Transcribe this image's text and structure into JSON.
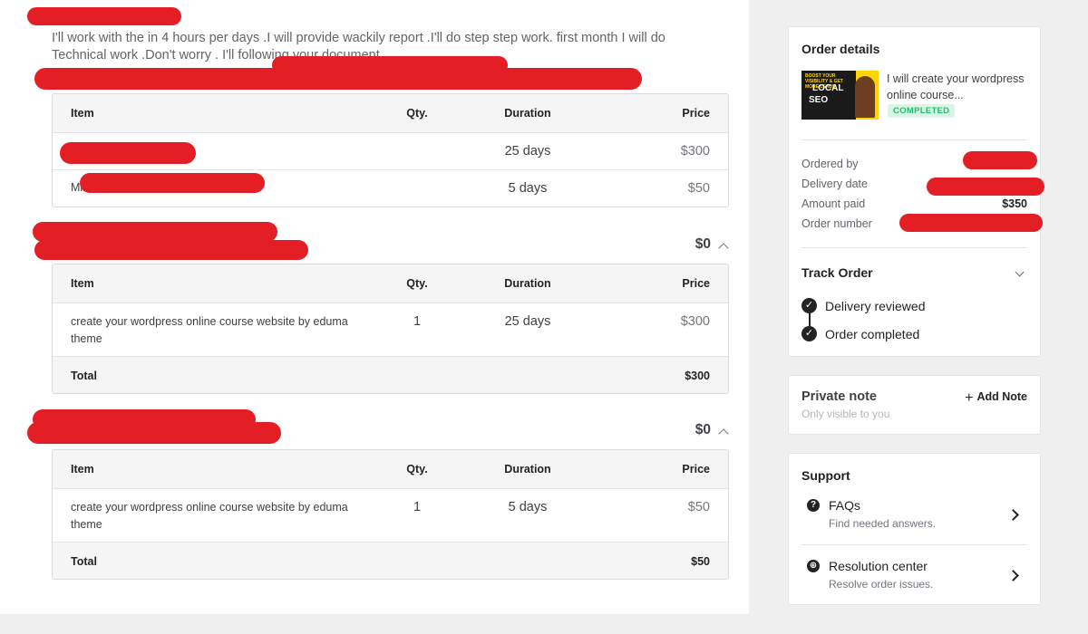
{
  "description": "I'll work with the in 4 hours per days .I will provide wackily report .I'll do step step work. first month I will do Technical work .Don't worry . I'll following your document.",
  "headers": {
    "item": "Item",
    "qty": "Qty.",
    "duration": "Duration",
    "price": "Price"
  },
  "milestones_table": {
    "rows": [
      {
        "duration": "25 days",
        "price": "$300"
      },
      {
        "item": "Milesto",
        "duration": "5 days",
        "price": "$50"
      }
    ]
  },
  "section2": {
    "amount": "$0",
    "row": {
      "item": "create your wordpress online course website by eduma theme",
      "qty": "1",
      "duration": "25 days",
      "price": "$300"
    },
    "total_label": "Total",
    "total_value": "$300"
  },
  "section3": {
    "amount": "$0",
    "row": {
      "item": "create your wordpress online course website by eduma theme",
      "qty": "1",
      "duration": "5 days",
      "price": "$50"
    },
    "total_label": "Total",
    "total_value": "$50"
  },
  "order_details": {
    "title": "Order details",
    "thumb_lines": [
      "BOOST YOUR VISIBILITY & GET MORE LEADS",
      "LOCAL",
      "SEO"
    ],
    "gig_title": "I will create your wordpress online course...",
    "status": "COMPLETED",
    "ordered_by_label": "Ordered by",
    "delivery_date_label": "Delivery date",
    "amount_paid_label": "Amount paid",
    "amount_paid_value": "$350",
    "order_number_label": "Order number"
  },
  "track_order": {
    "title": "Track Order",
    "steps": [
      "Delivery reviewed",
      "Order completed"
    ]
  },
  "private_note": {
    "title": "Private note",
    "subtitle": "Only visible to you",
    "add_label": "Add Note"
  },
  "support": {
    "title": "Support",
    "items": [
      {
        "title": "FAQs",
        "subtitle": "Find needed answers.",
        "icon": "question-icon"
      },
      {
        "title": "Resolution center",
        "subtitle": "Resolve order issues.",
        "icon": "lifebuoy-icon"
      }
    ]
  },
  "colors": {
    "redaction": "#e31e24",
    "success": "#1dbf73",
    "badge_bg": "#dbf5e5"
  }
}
